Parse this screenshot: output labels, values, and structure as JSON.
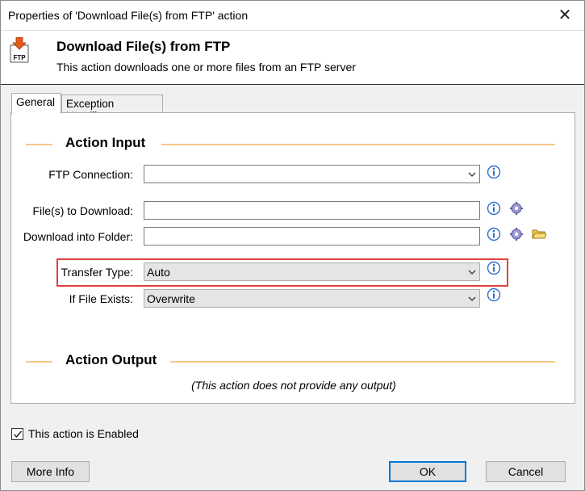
{
  "window": {
    "title": "Properties of 'Download File(s) from FTP' action",
    "close_symbol": "✕"
  },
  "header": {
    "icon": "ftp-download-icon",
    "icon_text": "FTP",
    "title": "Download File(s) from FTP",
    "description": "This action downloads one or more files from an FTP server"
  },
  "tabs": [
    {
      "label": "General",
      "active": true
    },
    {
      "label": "Exception Handling",
      "active": false
    }
  ],
  "action_input": {
    "heading": "Action Input",
    "ftp_connection": {
      "label": "FTP Connection:",
      "value": ""
    },
    "files_to_download": {
      "label": "File(s) to Download:",
      "value": ""
    },
    "download_into_folder": {
      "label": "Download into Folder:",
      "value": ""
    },
    "transfer_type": {
      "label": "Transfer Type:",
      "value": "Auto"
    },
    "if_file_exists": {
      "label": "If File Exists:",
      "value": "Overwrite"
    }
  },
  "action_output": {
    "heading": "Action Output",
    "note": "(This action does not provide any output)"
  },
  "footer": {
    "enabled_label": "This action is Enabled",
    "enabled_checked": true,
    "more_info_label": "More Info",
    "ok_label": "OK",
    "cancel_label": "Cancel"
  },
  "colors": {
    "section_line": "#f5c98a",
    "highlight_border": "#e24040",
    "default_button_border": "#0078d7"
  }
}
